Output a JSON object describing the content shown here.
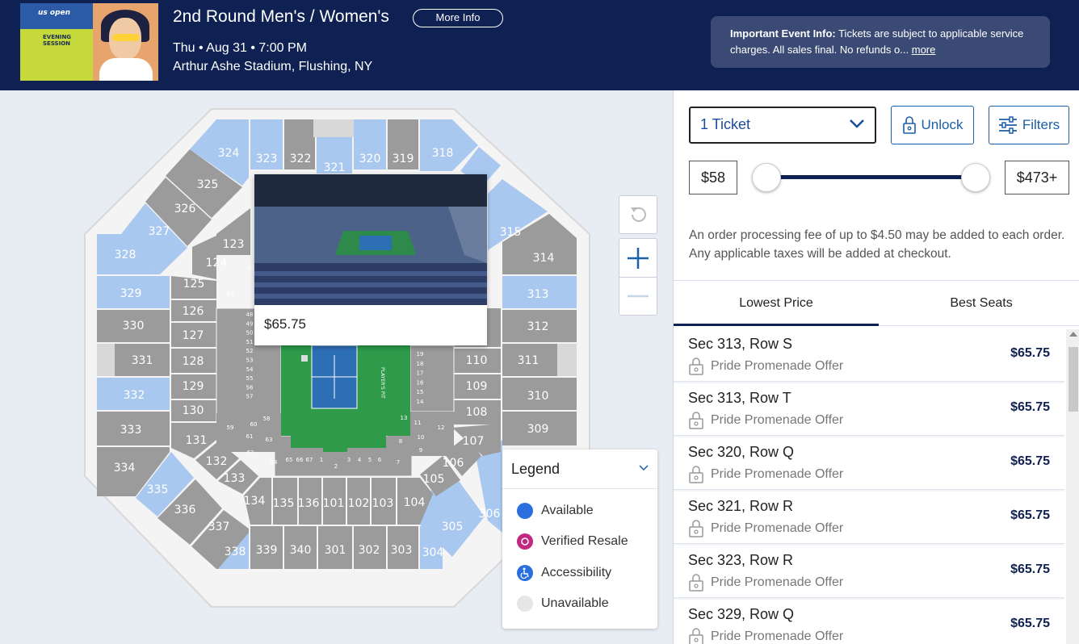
{
  "header": {
    "image_logo": "us open",
    "image_subtitle": "EVENING SESSION",
    "title": "2nd Round Men's / Women's",
    "more_info_label": "More Info",
    "date": "Thu • Aug 31 • 7:00 PM",
    "venue": "Arthur Ashe Stadium, Flushing, NY",
    "notice_bold": "Important Event Info:",
    "notice_text": " Tickets are subject to applicable service charges. All sales final. No refunds o...",
    "notice_link": "more"
  },
  "colors": {
    "header_bg": "#0f2152",
    "available_blue": "#a9c8ef",
    "unavailable_gray": "#9b9b9b",
    "court_green": "#2f9a4a",
    "accent_blue": "#1b5eaa",
    "resale_magenta": "#c2287f"
  },
  "map": {
    "popup_price": "$65.75",
    "section_labels": [
      "324",
      "323",
      "322",
      "321",
      "320",
      "319",
      "318",
      "325",
      "326",
      "327",
      "328",
      "329",
      "330",
      "331",
      "332",
      "333",
      "334",
      "335",
      "336",
      "337",
      "338",
      "339",
      "340",
      "301",
      "302",
      "303",
      "304",
      "305",
      "306",
      "309",
      "310",
      "311",
      "312",
      "313",
      "314",
      "315",
      "123",
      "124",
      "125",
      "126",
      "127",
      "128",
      "129",
      "130",
      "131",
      "132",
      "133",
      "134",
      "135",
      "136",
      "101",
      "102",
      "103",
      "104",
      "105",
      "106",
      "107",
      "108",
      "109",
      "110"
    ],
    "court_rows_left": [
      "48",
      "49",
      "50",
      "51",
      "52",
      "53",
      "54",
      "55",
      "56",
      "57"
    ],
    "court_rows_right": [
      "19",
      "18",
      "17",
      "16",
      "15",
      "14"
    ],
    "court_label": "PLAYER'S PIT",
    "small_sections": [
      "65",
      "66",
      "67",
      "1",
      "2",
      "3",
      "4",
      "5",
      "6",
      "7",
      "64",
      "62",
      "61",
      "60",
      "59",
      "58",
      "63",
      "8",
      "9",
      "10",
      "11",
      "12",
      "13",
      "45",
      "46"
    ],
    "controls": {
      "reset_icon": "reset-icon",
      "zoom_in_icon": "plus-icon",
      "zoom_out_icon": "minus-icon"
    }
  },
  "legend": {
    "title": "Legend",
    "items": [
      {
        "label": "Available",
        "color": "#2b6fde",
        "icon": "circle"
      },
      {
        "label": "Verified Resale",
        "color": "#c2287f",
        "icon": "resale-icon"
      },
      {
        "label": "Accessibility",
        "color": "#2b6fde",
        "icon": "wheelchair-icon"
      },
      {
        "label": "Unavailable",
        "color": "#e6e6e6",
        "icon": "circle"
      }
    ]
  },
  "panel": {
    "quantity": "1 Ticket",
    "unlock_label": "Unlock",
    "filters_label": "Filters",
    "min_price": "$58",
    "max_price": "$473+",
    "fee_text": "An order processing fee of up to $4.50 may be added to each order. Any applicable taxes will be added at checkout.",
    "tabs": [
      {
        "label": "Lowest Price",
        "selected": true
      },
      {
        "label": "Best Seats",
        "selected": false
      }
    ],
    "listings": [
      {
        "section": "Sec 313, Row S",
        "offer": "Pride Promenade Offer",
        "price": "$65.75"
      },
      {
        "section": "Sec 313, Row T",
        "offer": "Pride Promenade Offer",
        "price": "$65.75"
      },
      {
        "section": "Sec 320, Row Q",
        "offer": "Pride Promenade Offer",
        "price": "$65.75"
      },
      {
        "section": "Sec 321, Row R",
        "offer": "Pride Promenade Offer",
        "price": "$65.75"
      },
      {
        "section": "Sec 323, Row R",
        "offer": "Pride Promenade Offer",
        "price": "$65.75"
      },
      {
        "section": "Sec 329, Row Q",
        "offer": "Pride Promenade Offer",
        "price": "$65.75"
      }
    ]
  }
}
